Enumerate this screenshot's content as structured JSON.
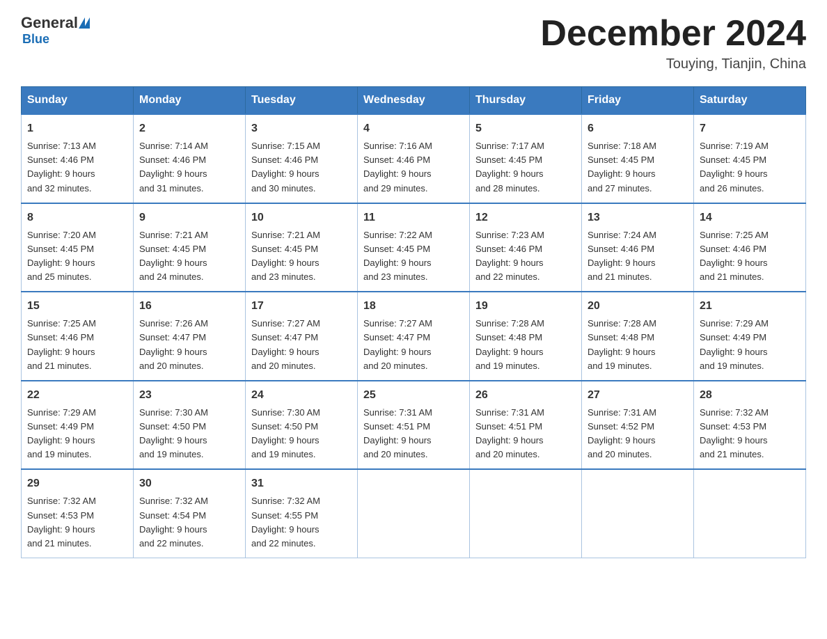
{
  "header": {
    "logo": {
      "general": "General",
      "blue": "Blue"
    },
    "title": "December 2024",
    "subtitle": "Touying, Tianjin, China"
  },
  "calendar": {
    "days_of_week": [
      "Sunday",
      "Monday",
      "Tuesday",
      "Wednesday",
      "Thursday",
      "Friday",
      "Saturday"
    ],
    "weeks": [
      [
        {
          "day": "1",
          "sunrise": "7:13 AM",
          "sunset": "4:46 PM",
          "daylight": "9 hours and 32 minutes."
        },
        {
          "day": "2",
          "sunrise": "7:14 AM",
          "sunset": "4:46 PM",
          "daylight": "9 hours and 31 minutes."
        },
        {
          "day": "3",
          "sunrise": "7:15 AM",
          "sunset": "4:46 PM",
          "daylight": "9 hours and 30 minutes."
        },
        {
          "day": "4",
          "sunrise": "7:16 AM",
          "sunset": "4:46 PM",
          "daylight": "9 hours and 29 minutes."
        },
        {
          "day": "5",
          "sunrise": "7:17 AM",
          "sunset": "4:45 PM",
          "daylight": "9 hours and 28 minutes."
        },
        {
          "day": "6",
          "sunrise": "7:18 AM",
          "sunset": "4:45 PM",
          "daylight": "9 hours and 27 minutes."
        },
        {
          "day": "7",
          "sunrise": "7:19 AM",
          "sunset": "4:45 PM",
          "daylight": "9 hours and 26 minutes."
        }
      ],
      [
        {
          "day": "8",
          "sunrise": "7:20 AM",
          "sunset": "4:45 PM",
          "daylight": "9 hours and 25 minutes."
        },
        {
          "day": "9",
          "sunrise": "7:21 AM",
          "sunset": "4:45 PM",
          "daylight": "9 hours and 24 minutes."
        },
        {
          "day": "10",
          "sunrise": "7:21 AM",
          "sunset": "4:45 PM",
          "daylight": "9 hours and 23 minutes."
        },
        {
          "day": "11",
          "sunrise": "7:22 AM",
          "sunset": "4:45 PM",
          "daylight": "9 hours and 23 minutes."
        },
        {
          "day": "12",
          "sunrise": "7:23 AM",
          "sunset": "4:46 PM",
          "daylight": "9 hours and 22 minutes."
        },
        {
          "day": "13",
          "sunrise": "7:24 AM",
          "sunset": "4:46 PM",
          "daylight": "9 hours and 21 minutes."
        },
        {
          "day": "14",
          "sunrise": "7:25 AM",
          "sunset": "4:46 PM",
          "daylight": "9 hours and 21 minutes."
        }
      ],
      [
        {
          "day": "15",
          "sunrise": "7:25 AM",
          "sunset": "4:46 PM",
          "daylight": "9 hours and 21 minutes."
        },
        {
          "day": "16",
          "sunrise": "7:26 AM",
          "sunset": "4:47 PM",
          "daylight": "9 hours and 20 minutes."
        },
        {
          "day": "17",
          "sunrise": "7:27 AM",
          "sunset": "4:47 PM",
          "daylight": "9 hours and 20 minutes."
        },
        {
          "day": "18",
          "sunrise": "7:27 AM",
          "sunset": "4:47 PM",
          "daylight": "9 hours and 20 minutes."
        },
        {
          "day": "19",
          "sunrise": "7:28 AM",
          "sunset": "4:48 PM",
          "daylight": "9 hours and 19 minutes."
        },
        {
          "day": "20",
          "sunrise": "7:28 AM",
          "sunset": "4:48 PM",
          "daylight": "9 hours and 19 minutes."
        },
        {
          "day": "21",
          "sunrise": "7:29 AM",
          "sunset": "4:49 PM",
          "daylight": "9 hours and 19 minutes."
        }
      ],
      [
        {
          "day": "22",
          "sunrise": "7:29 AM",
          "sunset": "4:49 PM",
          "daylight": "9 hours and 19 minutes."
        },
        {
          "day": "23",
          "sunrise": "7:30 AM",
          "sunset": "4:50 PM",
          "daylight": "9 hours and 19 minutes."
        },
        {
          "day": "24",
          "sunrise": "7:30 AM",
          "sunset": "4:50 PM",
          "daylight": "9 hours and 19 minutes."
        },
        {
          "day": "25",
          "sunrise": "7:31 AM",
          "sunset": "4:51 PM",
          "daylight": "9 hours and 20 minutes."
        },
        {
          "day": "26",
          "sunrise": "7:31 AM",
          "sunset": "4:51 PM",
          "daylight": "9 hours and 20 minutes."
        },
        {
          "day": "27",
          "sunrise": "7:31 AM",
          "sunset": "4:52 PM",
          "daylight": "9 hours and 20 minutes."
        },
        {
          "day": "28",
          "sunrise": "7:32 AM",
          "sunset": "4:53 PM",
          "daylight": "9 hours and 21 minutes."
        }
      ],
      [
        {
          "day": "29",
          "sunrise": "7:32 AM",
          "sunset": "4:53 PM",
          "daylight": "9 hours and 21 minutes."
        },
        {
          "day": "30",
          "sunrise": "7:32 AM",
          "sunset": "4:54 PM",
          "daylight": "9 hours and 22 minutes."
        },
        {
          "day": "31",
          "sunrise": "7:32 AM",
          "sunset": "4:55 PM",
          "daylight": "9 hours and 22 minutes."
        },
        null,
        null,
        null,
        null
      ]
    ],
    "labels": {
      "sunrise": "Sunrise:",
      "sunset": "Sunset:",
      "daylight": "Daylight:"
    }
  }
}
